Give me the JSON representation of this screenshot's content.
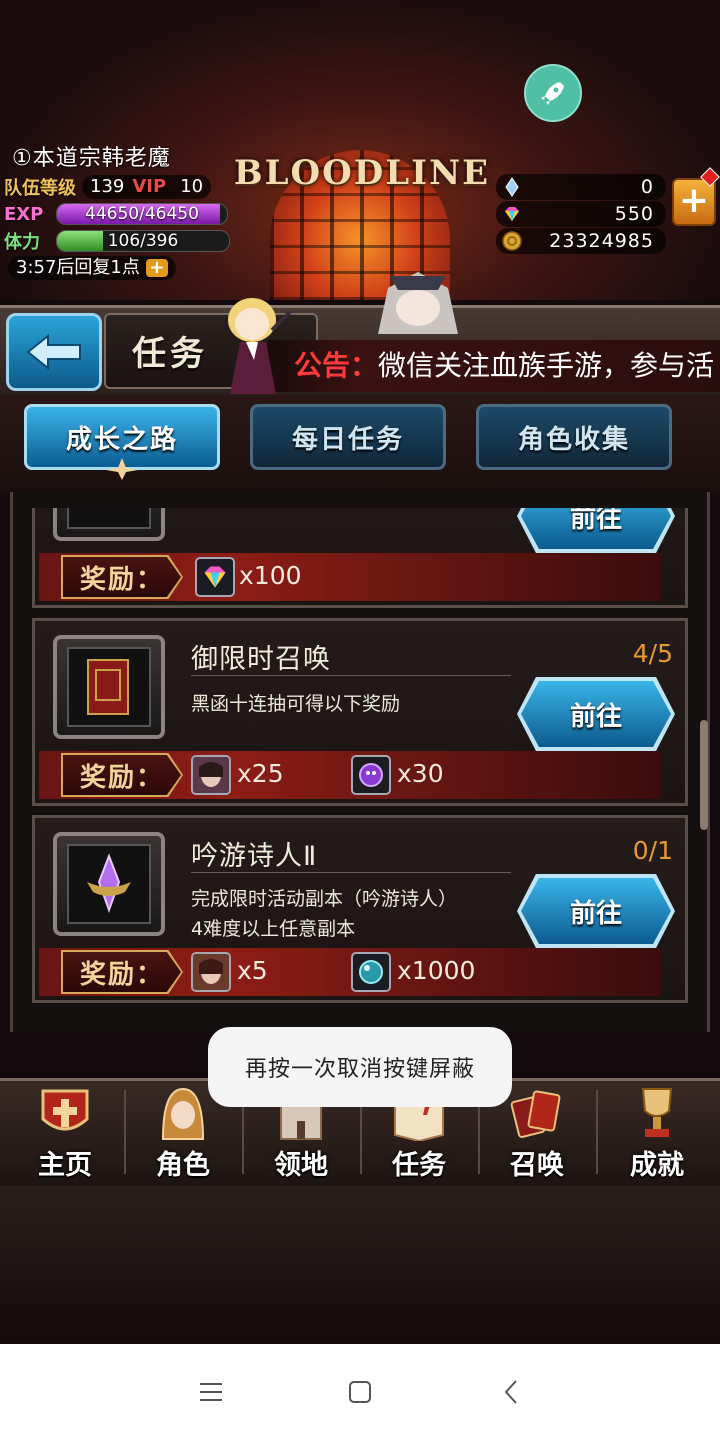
{
  "player": {
    "name": "①本道宗韩老魔",
    "team_level_label": "队伍等级",
    "team_level": "139",
    "vip_label": "VIP",
    "vip": "10",
    "exp_label": "EXP",
    "exp": "44650/46450",
    "exp_fraction": 0.961,
    "stamina_label": "体力",
    "stamina": "106/396",
    "stamina_fraction": 0.268,
    "recover_text": "3:57后回复1点"
  },
  "resources": [
    {
      "icon": "crystal-icon",
      "value": "0"
    },
    {
      "icon": "rainbow-gem-icon",
      "value": "550"
    },
    {
      "icon": "gold-coin-icon",
      "value": "23324985"
    }
  ],
  "logo": "BLOODLINE",
  "header": {
    "title": "任务",
    "notice_label": "公告：",
    "notice_text": "微信关注血族手游，参与活"
  },
  "tabs": [
    {
      "label": "成长之路",
      "active": true
    },
    {
      "label": "每日任务",
      "active": false
    },
    {
      "label": "角色收集",
      "active": false
    }
  ],
  "quests": [
    {
      "title": "",
      "desc1": "",
      "desc2": "",
      "progress": "",
      "go_label": "前往",
      "reward_label": "奖励：",
      "rewards": [
        {
          "icon": "rainbow-gem-icon",
          "qty": "x100"
        }
      ]
    },
    {
      "title": "御限时召唤",
      "desc1": "黑函十连抽可得以下奖励",
      "desc2": "",
      "progress": "4/5",
      "go_label": "前往",
      "reward_label": "奖励：",
      "rewards": [
        {
          "icon": "hero-fragment-icon",
          "qty": "x25"
        },
        {
          "icon": "purple-orb-icon",
          "qty": "x30"
        }
      ]
    },
    {
      "title": "吟游诗人Ⅱ",
      "desc1": "完成限时活动副本（吟游诗人）",
      "desc2": "4难度以上任意副本",
      "progress": "0/1",
      "go_label": "前往",
      "reward_label": "奖励：",
      "rewards": [
        {
          "icon": "hero-fragment-icon",
          "qty": "x5"
        },
        {
          "icon": "teal-orb-icon",
          "qty": "x1000"
        }
      ]
    }
  ],
  "toast": "再按一次取消按键屏蔽",
  "nav": [
    {
      "label": "主页",
      "icon": "home-shield-icon"
    },
    {
      "label": "角色",
      "icon": "character-hood-icon"
    },
    {
      "label": "领地",
      "icon": "castle-icon"
    },
    {
      "label": "任务",
      "icon": "quest-book-icon"
    },
    {
      "label": "召唤",
      "icon": "summon-cards-icon"
    },
    {
      "label": "成就",
      "icon": "trophy-icon"
    }
  ],
  "colors": {
    "accent_blue": "#2aa4d8",
    "progress_orange": "#e79a2f",
    "notice_red": "#ff3a3a",
    "exp_purple": "#b23ad8",
    "stamina_green": "#4fbf3a"
  }
}
